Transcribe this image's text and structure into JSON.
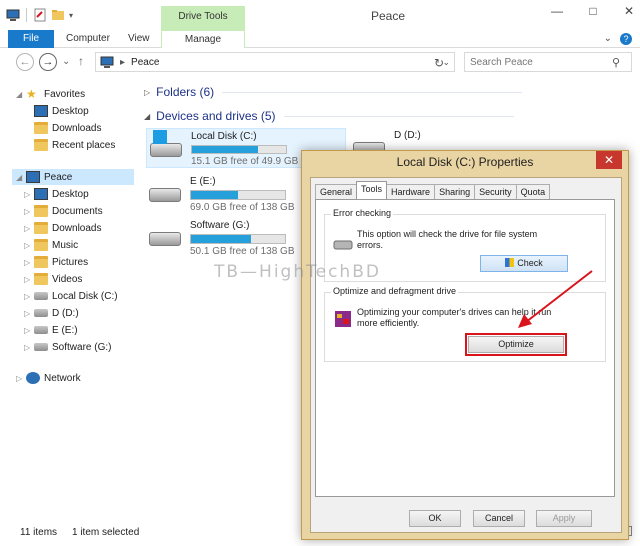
{
  "window": {
    "title": "Peace",
    "drive_tools_label": "Drive Tools",
    "controls": {
      "minimize": "—",
      "maximize": "□",
      "close": "✕"
    }
  },
  "ribbon": {
    "tabs": [
      {
        "label": "File"
      },
      {
        "label": "Computer"
      },
      {
        "label": "View"
      },
      {
        "label": "Manage"
      }
    ],
    "expand_glyph": "⌄",
    "help_glyph": "?"
  },
  "navigation": {
    "back_glyph": "←",
    "forward_glyph": "→",
    "history_glyph": "⌄",
    "up_glyph": "↑",
    "address_arrow": "▸",
    "address": "Peace",
    "address_dropdown": "⌄",
    "refresh_glyph": "↻",
    "search_placeholder": "Search Peace",
    "search_glyph": "⚲"
  },
  "tree": {
    "favorites": {
      "label": "Favorites",
      "items": [
        "Desktop",
        "Downloads",
        "Recent places"
      ]
    },
    "pc": {
      "label": "Peace",
      "items": [
        "Desktop",
        "Documents",
        "Downloads",
        "Music",
        "Pictures",
        "Videos",
        "Local Disk (C:)",
        "D (D:)",
        "E (E:)",
        "Software (G:)"
      ]
    },
    "network": {
      "label": "Network"
    }
  },
  "content": {
    "folders_header": "Folders (6)",
    "devices_header": "Devices and drives (5)",
    "drives": [
      {
        "name": "Local Disk (C:)",
        "free": "15.1 GB free of 49.9 GB",
        "used_fraction": 0.7,
        "system": true
      },
      {
        "name": "D (D:)",
        "free": "",
        "used_fraction": 0,
        "system": false
      },
      {
        "name": "E (E:)",
        "free": "69.0 GB free of 138 GB",
        "used_fraction": 0.5,
        "system": false
      },
      {
        "name": "Software (G:)",
        "free": "50.1 GB free of 138 GB",
        "used_fraction": 0.64,
        "system": false
      }
    ]
  },
  "status": {
    "items_count": "11 items",
    "selected_count": "1 item selected"
  },
  "dialog": {
    "title": "Local Disk (C:) Properties",
    "close_glyph": "✕",
    "tabs": [
      "General",
      "Tools",
      "Hardware",
      "Sharing",
      "Security",
      "Quota"
    ],
    "active_tab": "Tools",
    "error_checking": {
      "label": "Error checking",
      "text": "This option will check the drive for file system errors.",
      "button": "Check"
    },
    "optimize": {
      "label": "Optimize and defragment drive",
      "text": "Optimizing your computer's drives can help it run more efficiently.",
      "button": "Optimize"
    },
    "buttons": {
      "ok": "OK",
      "cancel": "Cancel",
      "apply": "Apply"
    }
  },
  "watermark": "TB—HighTechBD",
  "colors": {
    "accent": "#1979ca",
    "drive_tools": "#c8ecb8",
    "drive_bar": "#26a0da",
    "dialog_frame": "#e9d4a3",
    "close_button": "#c7372e",
    "annotation_red": "#d9141b"
  }
}
